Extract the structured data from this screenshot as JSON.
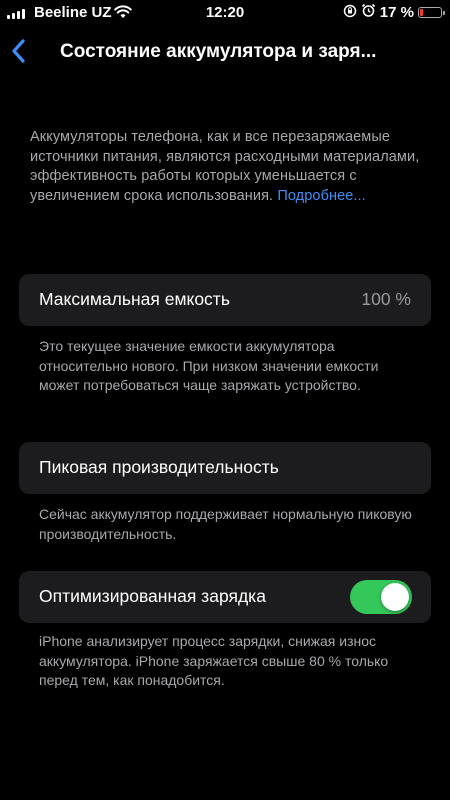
{
  "status_bar": {
    "carrier": "Beeline UZ",
    "time": "12:20",
    "battery_percent_text": "17 %",
    "battery_level": 0.17,
    "icons": [
      "signal-icon",
      "wifi-icon",
      "orientation-lock-icon",
      "alarm-icon",
      "battery-icon"
    ]
  },
  "nav": {
    "back_icon": "chevron-left-icon",
    "title": "Состояние аккумулятора и заря..."
  },
  "intro": {
    "text": "Аккумуляторы телефона, как и все перезаряжаемые источники питания, являются расходными материалами, эффективность работы которых уменьшается с увеличением срока использования.",
    "link": "Подробнее..."
  },
  "max_capacity": {
    "label": "Максимальная емкость",
    "value": "100 %",
    "footnote": "Это текущее значение емкости аккумулятора относительно нового. При низком значении емкости может потребоваться чаще заряжать устройство."
  },
  "peak_performance": {
    "label": "Пиковая производительность",
    "footnote": "Сейчас аккумулятор поддерживает нормальную пиковую производительность."
  },
  "optimized_charging": {
    "label": "Оптимизированная зарядка",
    "enabled": true,
    "footnote": "iPhone анализирует процесс зарядки, снижая износ аккумулятора. iPhone заряжается свыше 80 % только перед тем, как понадобится."
  },
  "colors": {
    "background": "#000000",
    "cell": "#1c1c1e",
    "secondary_text": "#a8a8ad",
    "link": "#3e8ef7",
    "toggle_on": "#34c759",
    "battery_low": "#ff3b30"
  }
}
